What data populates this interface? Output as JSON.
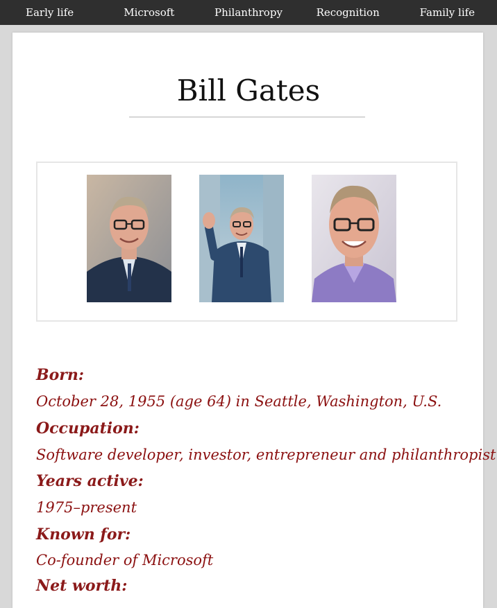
{
  "nav": {
    "items": [
      "Early life",
      "Microsoft",
      "Philanthropy",
      "Recognition",
      "Family life"
    ]
  },
  "page": {
    "title": "Bill Gates"
  },
  "gallery": {
    "photos": [
      "portrait-photo",
      "waving-photo",
      "smiling-photo"
    ]
  },
  "info": {
    "born_label": "Born:",
    "born_value": "October 28, 1955 (age 64) in Seattle, Washington, U.S.",
    "occupation_label": "Occupation:",
    "occupation_value": "Software developer, investor, entrepreneur and philanthropist",
    "years_label": "Years active:",
    "years_value": "1975–present",
    "known_label": "Known for:",
    "known_value": "Co-founder of Microsoft",
    "networth_label": "Net worth:"
  },
  "colors": {
    "nav_bg": "#2f2f2f",
    "accent": "#8b1010",
    "page_bg": "#d8d8d8"
  }
}
